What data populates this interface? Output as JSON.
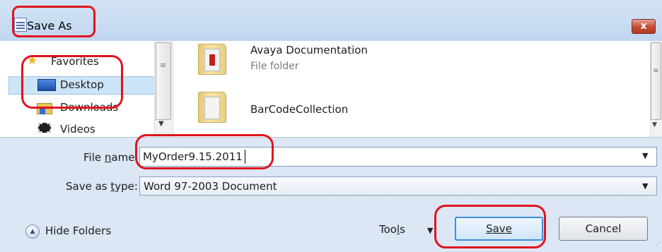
{
  "window": {
    "title": "Save As",
    "close_label": "x"
  },
  "navigation": {
    "items": [
      {
        "label": "Favorites",
        "icon": "star-icon"
      },
      {
        "label": "Desktop",
        "icon": "desktop-icon",
        "selected": true
      },
      {
        "label": "Downloads",
        "icon": "downloads-folder-icon"
      },
      {
        "label": "Videos",
        "icon": "videos-icon"
      }
    ],
    "scroll_grip": "≡",
    "scroll_down": "▼"
  },
  "file_list": {
    "items": [
      {
        "name": "Avaya Documentation",
        "type": "File folder",
        "icon": "folder-icon"
      },
      {
        "name": "BarCodeCollection",
        "type": "",
        "icon": "folder-icon"
      }
    ],
    "scroll_grip": "≡",
    "scroll_down": "▼"
  },
  "form": {
    "file_name_label": "File name:",
    "file_name_value": "MyOrder9.15.2011",
    "save_type_label": "Save as type:",
    "save_type_value": "Word 97-2003 Document",
    "dropdown_arrow": "▼"
  },
  "footer": {
    "hide_folders_label": "Hide Folders",
    "hide_folders_icon": "▲",
    "tools_label": "Tools",
    "tools_arrow": "▼",
    "save_label": "Save",
    "cancel_label": "Cancel",
    "resize_grip": "⋰"
  },
  "colors": {
    "annotation": "#e0141e",
    "title_bar": "#c8dcf2",
    "selection": "#cce4f7",
    "close_button": "#c44a32"
  }
}
